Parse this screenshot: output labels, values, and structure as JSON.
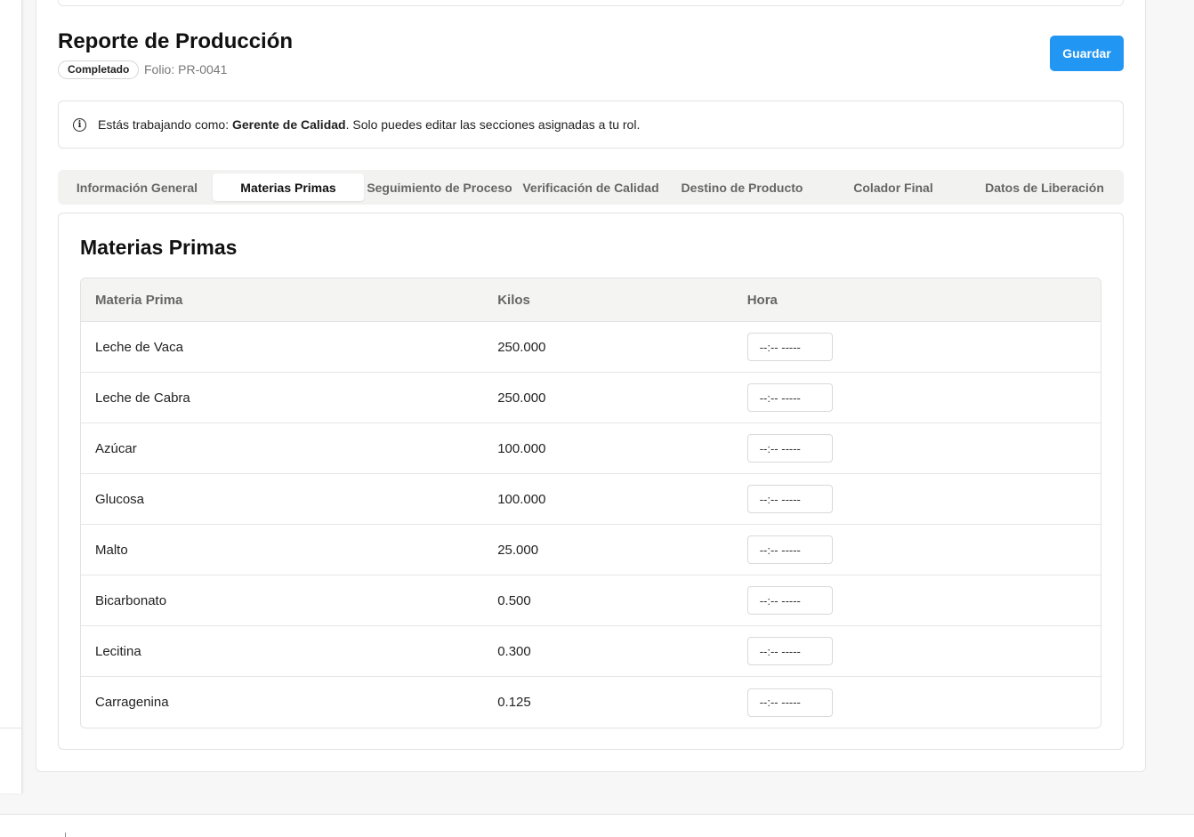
{
  "header": {
    "title": "Reporte de Producción",
    "status": "Completado",
    "folio_label": "Folio:",
    "folio_value": "PR-0041",
    "save_label": "Guardar"
  },
  "notice": {
    "prefix": "Estás trabajando como: ",
    "role": "Gerente de Calidad",
    "suffix": ". Solo puedes editar las secciones asignadas a tu rol."
  },
  "tabs": [
    {
      "label": "Información General",
      "active": false
    },
    {
      "label": "Materias Primas",
      "active": true
    },
    {
      "label": "Seguimiento de Proceso",
      "active": false
    },
    {
      "label": "Verificación de Calidad",
      "active": false
    },
    {
      "label": "Destino de Producto",
      "active": false
    },
    {
      "label": "Colador Final",
      "active": false
    },
    {
      "label": "Datos de Liberación",
      "active": false
    }
  ],
  "section": {
    "title": "Materias Primas",
    "columns": [
      "Materia Prima",
      "Kilos",
      "Hora"
    ],
    "time_placeholder": "--:-- -----",
    "rows": [
      {
        "material": "Leche de Vaca",
        "kilos": "250.000"
      },
      {
        "material": "Leche de Cabra",
        "kilos": "250.000"
      },
      {
        "material": "Azúcar",
        "kilos": "100.000"
      },
      {
        "material": "Glucosa",
        "kilos": "100.000"
      },
      {
        "material": "Malto",
        "kilos": "25.000"
      },
      {
        "material": "Bicarbonato",
        "kilos": "0.500"
      },
      {
        "material": "Lecitina",
        "kilos": "0.300"
      },
      {
        "material": "Carragenina",
        "kilos": "0.125"
      }
    ]
  },
  "colors": {
    "accent": "#2196f3",
    "tab_background": "#f2f2f1",
    "table_header_background": "#f4f4f2"
  }
}
